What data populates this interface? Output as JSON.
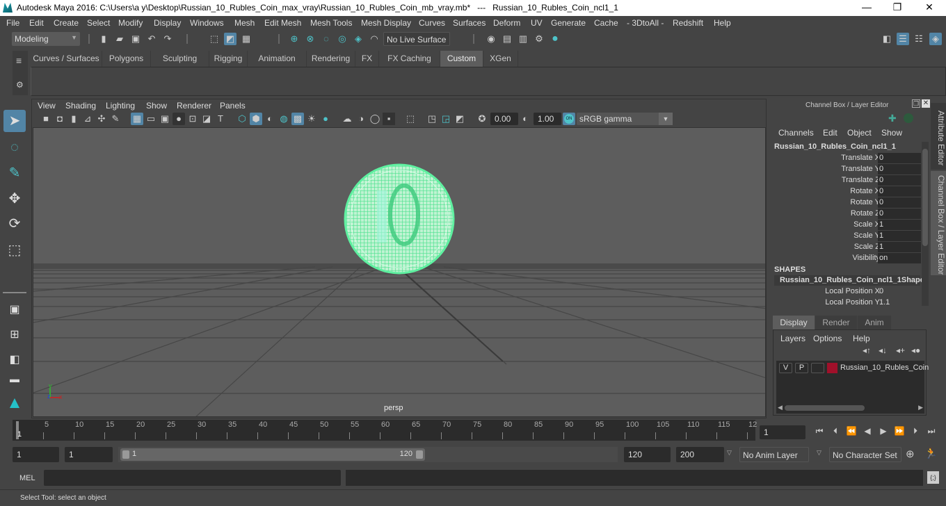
{
  "window": {
    "title": "Autodesk Maya 2016: C:\\Users\\a y\\Desktop\\Russian_10_Rubles_Coin_max_vray\\Russian_10_Rubles_Coin_mb_vray.mb*   ---   Russian_10_Rubles_Coin_ncl1_1",
    "minimize": "—",
    "maximize": "❐",
    "close": "✕"
  },
  "menubar": [
    "File",
    "Edit",
    "Create",
    "Select",
    "Modify",
    "Display",
    "Windows",
    "Mesh",
    "Edit Mesh",
    "Mesh Tools",
    "Mesh Display",
    "Curves",
    "Surfaces",
    "Deform",
    "UV",
    "Generate",
    "Cache",
    "- 3DtoAll -",
    "Redshift",
    "Help"
  ],
  "statusline": {
    "mode": "Modeling",
    "live_surface": "No Live Surface"
  },
  "shelf_tabs": [
    {
      "label": "Curves / Surfaces",
      "active": false
    },
    {
      "label": "Polygons",
      "active": false
    },
    {
      "label": "Sculpting",
      "active": false
    },
    {
      "label": "Rigging",
      "active": false
    },
    {
      "label": "Animation",
      "active": false
    },
    {
      "label": "Rendering",
      "active": false
    },
    {
      "label": "FX",
      "active": false
    },
    {
      "label": "FX Caching",
      "active": false
    },
    {
      "label": "Custom",
      "active": true
    },
    {
      "label": "XGen",
      "active": false
    }
  ],
  "tools": [
    "select-tool",
    "lasso-tool",
    "paint-select-tool",
    "move-tool",
    "rotate-tool",
    "scale-tool"
  ],
  "viewport": {
    "menus": [
      "View",
      "Shading",
      "Lighting",
      "Show",
      "Renderer",
      "Panels"
    ],
    "exposure": "0.00",
    "gamma": "1.00",
    "color_mgmt": "ON",
    "colorspace": "sRGB gamma",
    "camera": "persp",
    "axis": {
      "x": "x",
      "y": "y",
      "z": "z"
    },
    "wire_color": "#5ef0a0"
  },
  "channel_box": {
    "title": "Channel Box / Layer Editor",
    "menus": [
      "Channels",
      "Edit",
      "Object",
      "Show"
    ],
    "object": "Russian_10_Rubles_Coin_ncl1_1",
    "channels": [
      {
        "label": "Translate X",
        "value": "0"
      },
      {
        "label": "Translate Y",
        "value": "0"
      },
      {
        "label": "Translate Z",
        "value": "0"
      },
      {
        "label": "Rotate X",
        "value": "0"
      },
      {
        "label": "Rotate Y",
        "value": "0"
      },
      {
        "label": "Rotate Z",
        "value": "0"
      },
      {
        "label": "Scale X",
        "value": "1"
      },
      {
        "label": "Scale Y",
        "value": "1"
      },
      {
        "label": "Scale Z",
        "value": "1"
      },
      {
        "label": "Visibility",
        "value": "on"
      }
    ],
    "shapes_header": "SHAPES",
    "shape_name": "Russian_10_Rubles_Coin_ncl1_1Shape",
    "shape_channels": [
      {
        "label": "Local Position X",
        "value": "0"
      },
      {
        "label": "Local Position Y",
        "value": "1.1"
      }
    ]
  },
  "layer_editor": {
    "tabs": [
      {
        "label": "Display",
        "active": true
      },
      {
        "label": "Render",
        "active": false
      },
      {
        "label": "Anim",
        "active": false
      }
    ],
    "menus": [
      "Layers",
      "Options",
      "Help"
    ],
    "layer": {
      "v": "V",
      "p": "P",
      "color": "#a0102a",
      "name": "Russian_10_Rubles_Coin"
    }
  },
  "side_tabs": [
    "Attribute Editor",
    "Channel Box / Layer Editor"
  ],
  "timeline": {
    "ticks": [
      "5",
      "10",
      "15",
      "20",
      "25",
      "30",
      "35",
      "40",
      "45",
      "50",
      "55",
      "60",
      "65",
      "70",
      "75",
      "80",
      "85",
      "90",
      "95",
      "100",
      "105",
      "110",
      "115",
      "12"
    ],
    "current_marker": "1",
    "current_frame": "1"
  },
  "range": {
    "start": "1",
    "playback_start": "1",
    "slider_start": "1",
    "slider_end": "120",
    "playback_end": "120",
    "end": "200",
    "anim_layer": "No Anim Layer",
    "character_set": "No Character Set"
  },
  "command_line": {
    "label": "MEL"
  },
  "status": {
    "help": "Select Tool: select an object"
  }
}
